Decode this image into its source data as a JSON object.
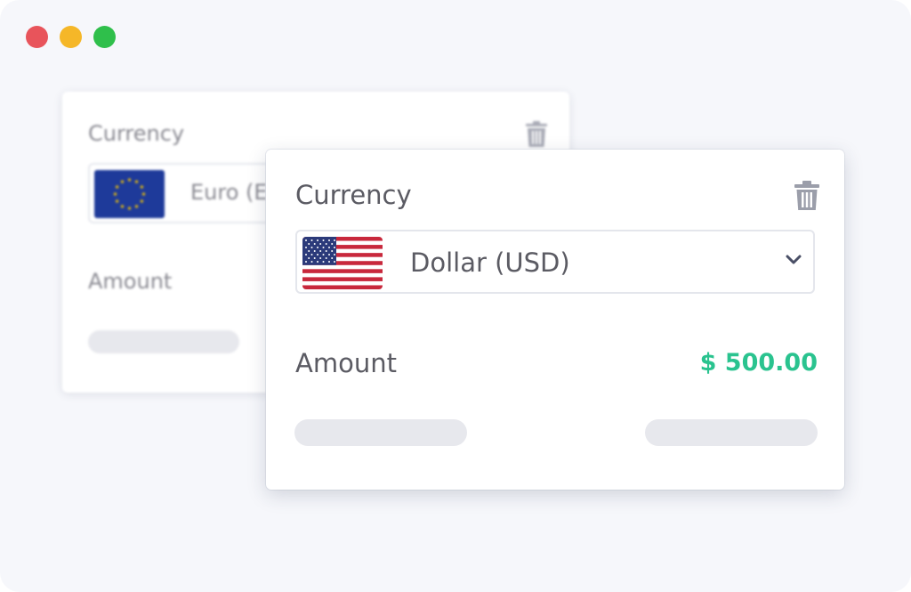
{
  "window": {
    "controls": [
      "close",
      "minimize",
      "maximize"
    ]
  },
  "back_card": {
    "currency_label": "Currency",
    "selected_currency": "Euro (E",
    "flag_icon": "eu-flag-icon",
    "amount_label": "Amount",
    "delete_icon": "trash-icon"
  },
  "front_card": {
    "currency_label": "Currency",
    "selected_currency": "Dollar (USD)",
    "flag_icon": "us-flag-icon",
    "dropdown_icon": "chevron-down-icon",
    "delete_icon": "trash-icon",
    "amount_label": "Amount",
    "amount_value": "$ 500.00"
  },
  "colors": {
    "amount_value": "#2ac38f",
    "close": "#e8545b",
    "minimize": "#f5b728",
    "maximize": "#2fbf4b"
  }
}
